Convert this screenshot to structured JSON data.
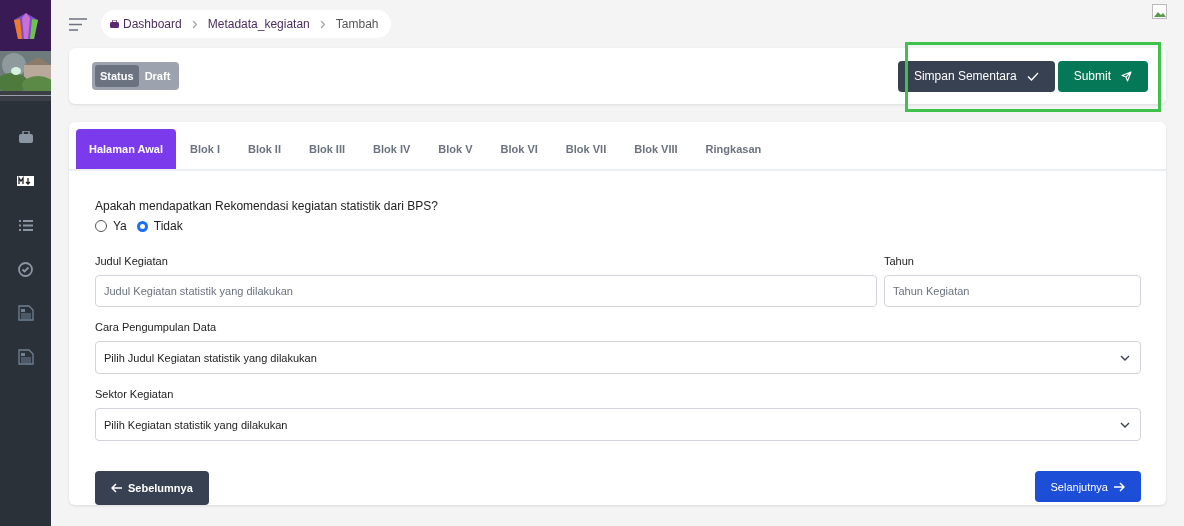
{
  "breadcrumb": [
    {
      "label": "Dashboard",
      "icon": true
    },
    {
      "label": "Metadata_kegiatan",
      "icon": false
    },
    {
      "label": "Tambah",
      "icon": false
    }
  ],
  "status": {
    "label": "Status",
    "value": "Draft"
  },
  "actions": [
    {
      "label": "Simpan Sementara",
      "kind": "save"
    },
    {
      "label": "Submit",
      "kind": "submit"
    }
  ],
  "tabs": [
    {
      "label": "Halaman Awal",
      "selected": true
    },
    {
      "label": "Blok I",
      "selected": false
    },
    {
      "label": "Blok II",
      "selected": false
    },
    {
      "label": "Blok III",
      "selected": false
    },
    {
      "label": "Blok IV",
      "selected": false
    },
    {
      "label": "Blok V",
      "selected": false
    },
    {
      "label": "Blok VI",
      "selected": false
    },
    {
      "label": "Blok VII",
      "selected": false
    },
    {
      "label": "Blok VIII",
      "selected": false
    },
    {
      "label": "Ringkasan",
      "selected": false
    }
  ],
  "question": {
    "label": "Apakah mendapatkan Rekomendasi kegiatan statistik dari BPS?",
    "options": [
      {
        "label": "Ya",
        "selected": false
      },
      {
        "label": "Tidak",
        "selected": true
      }
    ]
  },
  "fields": [
    {
      "label": "Judul Kegiatan",
      "placeholder": "Judul Kegiatan statistik yang dilakukan"
    },
    {
      "label": "Tahun",
      "placeholder": "Tahun Kegiatan"
    }
  ],
  "selects": [
    {
      "label": "Cara Pengumpulan Data",
      "value": "Pilih Judul Kegiatan statistik yang dilakukan"
    },
    {
      "label": "Sektor Kegiatan",
      "value": "Pilih Kegiatan statistik yang dilakukan"
    }
  ],
  "nav": {
    "prev": "Sebelumnya",
    "next": "Selanjutnya"
  },
  "sidebar": [
    {
      "kind": "briefcase"
    },
    {
      "kind": "markdown"
    },
    {
      "kind": "list"
    },
    {
      "kind": "check"
    },
    {
      "kind": "document"
    },
    {
      "kind": "document"
    }
  ]
}
